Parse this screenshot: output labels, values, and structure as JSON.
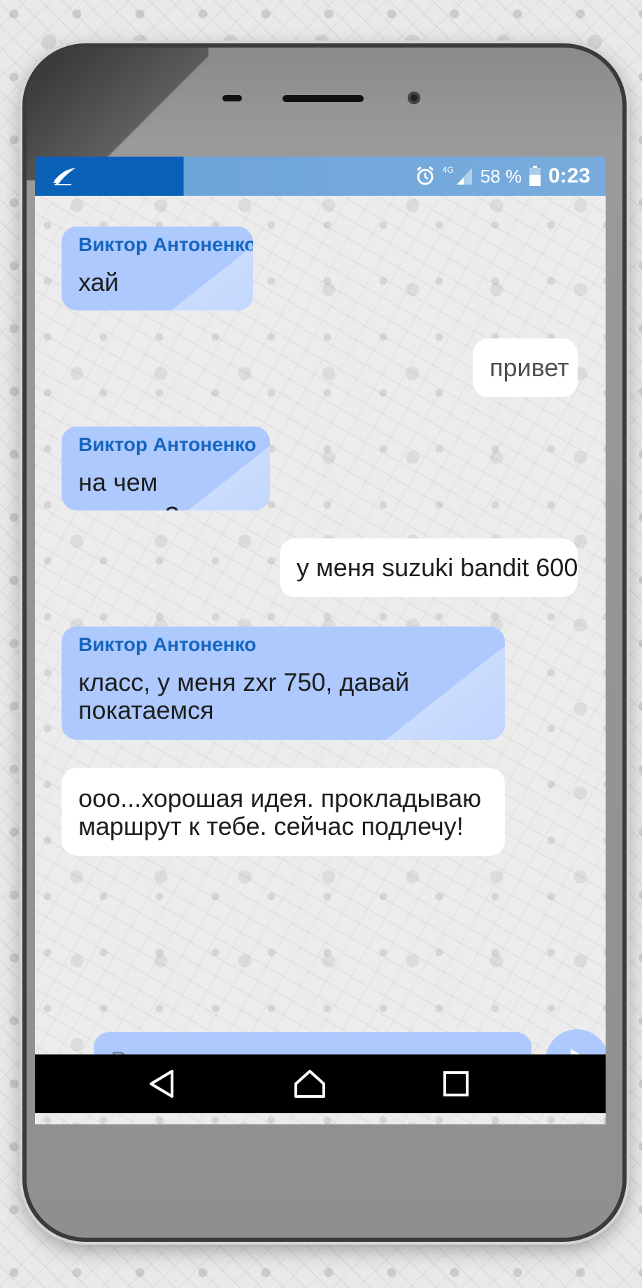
{
  "status_bar": {
    "network_type": "4G",
    "battery_percent": "58 %",
    "time": "0:23",
    "icons": [
      "app-icon",
      "alarm-icon",
      "signal-icon",
      "battery-icon"
    ]
  },
  "messages": [
    {
      "direction": "in",
      "sender": "Виктор Антоненко",
      "lines": [
        "хай"
      ]
    },
    {
      "direction": "out",
      "lines": [
        "привет"
      ]
    },
    {
      "direction": "in",
      "sender": "Виктор Антоненко",
      "lines": [
        "на чем ездишь?"
      ]
    },
    {
      "direction": "out",
      "lines": [
        "у меня suzuki bandit 600"
      ]
    },
    {
      "direction": "in",
      "sender": "Виктор Антоненко",
      "lines": [
        "класс, у меня zxr 750, давай",
        "покатаемся"
      ]
    },
    {
      "direction": "out",
      "lines": [
        "ооо...хорошая идея. прокладываю",
        "маршрут к тебе. сейчас подлечу!"
      ]
    }
  ],
  "input": {
    "placeholder": "Введите текст"
  },
  "nav_bar": {
    "icons": [
      "back-icon",
      "home-icon",
      "recents-icon"
    ]
  },
  "colors": {
    "status_bar_left": "#0a61b8",
    "status_bar_right": "#78acdd",
    "incoming_bubble": "#adc9fe",
    "outgoing_bubble": "#ffffff",
    "sender_name": "#1565c0",
    "nav_bar": "#000000"
  }
}
